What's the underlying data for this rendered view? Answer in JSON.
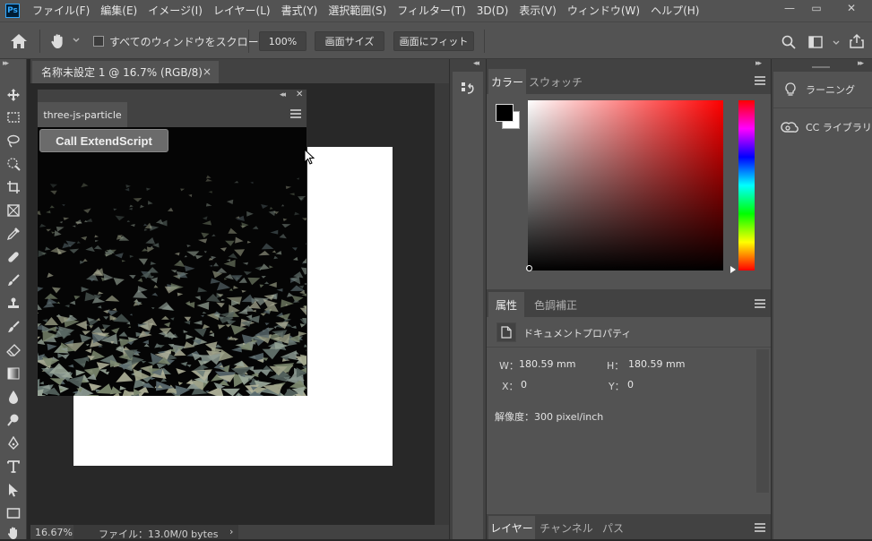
{
  "menubar": {
    "logo": "Ps",
    "items": [
      "ファイル(F)",
      "編集(E)",
      "イメージ(I)",
      "レイヤー(L)",
      "書式(Y)",
      "選択範囲(S)",
      "フィルター(T)",
      "3D(D)",
      "表示(V)",
      "ウィンドウ(W)",
      "ヘルプ(H)"
    ],
    "window_controls": {
      "minimize": "—",
      "restore": "▭",
      "close": "✕"
    }
  },
  "options_bar": {
    "scroll_all_label": "すべてのウィンドウをスクロール",
    "zoom_100": "100%",
    "fit_screen": "画面サイズ",
    "fill_screen": "画面にフィット"
  },
  "document": {
    "tab_title": "名称未設定 1 @ 16.7% (RGB/8)",
    "tab_close": "×",
    "status_zoom": "16.67%",
    "status_file": "ファイル：13.0M/0 bytes",
    "status_arrow": "›"
  },
  "extension_panel": {
    "tab_label": "three-js-particle",
    "button_label": "Call ExtendScript"
  },
  "color_panel": {
    "tabs": [
      "カラー",
      "スウォッチ"
    ],
    "foreground": "#000000",
    "background": "#ffffff"
  },
  "properties_panel": {
    "tabs": [
      "属性",
      "色調補正"
    ],
    "section_title": "ドキュメントプロパティ",
    "w_label": "W：",
    "w_value": "180.59 mm",
    "h_label": "H：",
    "h_value": "180.59 mm",
    "x_label": "X：",
    "x_value": "0",
    "y_label": "Y：",
    "y_value": "0",
    "resolution": "解像度：300 pixel/inch"
  },
  "layers_panel": {
    "tabs": [
      "レイヤー",
      "チャンネル",
      "パス"
    ]
  },
  "right_dock": {
    "learn_label": "ラーニング",
    "libraries_label": "CC ライブラリ"
  }
}
